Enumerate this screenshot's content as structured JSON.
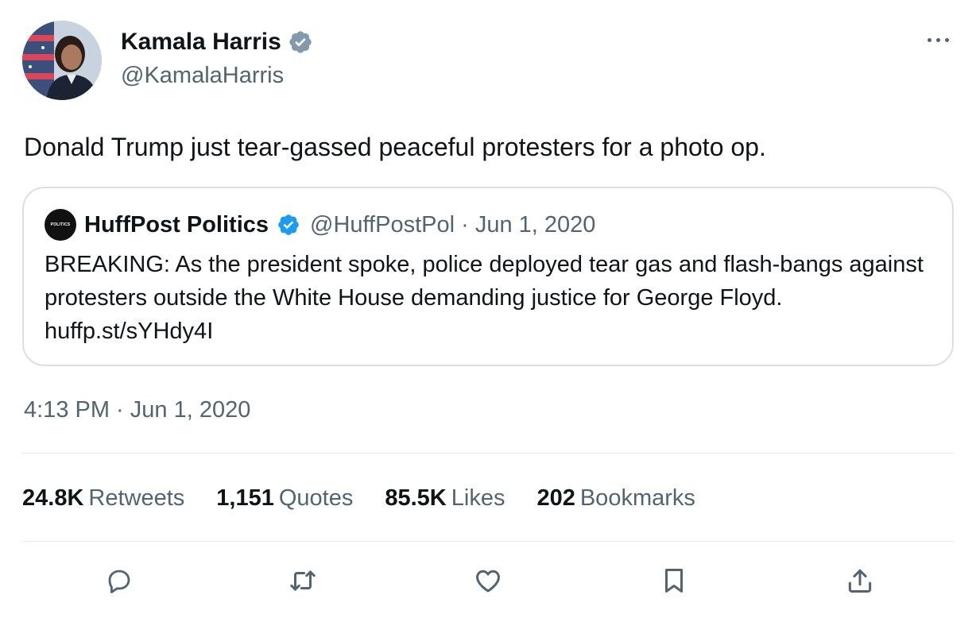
{
  "author": {
    "name": "Kamala Harris",
    "handle": "@KamalaHarris",
    "verified_color": "#829aab",
    "avatar_icon": "profile-photo"
  },
  "tweet": {
    "text": "Donald Trump just tear-gassed peaceful protesters for a photo op.",
    "timestamp": "4:13 PM · Jun 1, 2020"
  },
  "quoted": {
    "logo_text": "POLITICS",
    "name": "HuffPost Politics",
    "meta": "@HuffPostPol · Jun 1, 2020",
    "verified_color": "#1d9bf0",
    "text": "BREAKING: As the president spoke, police deployed tear gas and flash-bangs against protesters outside the White House demanding justice for George Floyd. huffp.st/sYHdy4I"
  },
  "stats": [
    {
      "value": "24.8K",
      "label": "Retweets"
    },
    {
      "value": "1,151",
      "label": "Quotes"
    },
    {
      "value": "85.5K",
      "label": "Likes"
    },
    {
      "value": "202",
      "label": "Bookmarks"
    }
  ],
  "actions": [
    "reply-icon",
    "retweet-icon",
    "like-icon",
    "bookmark-icon",
    "share-icon"
  ],
  "colors": {
    "text": "#0f1419",
    "muted": "#536471",
    "border": "#dadfe4"
  }
}
